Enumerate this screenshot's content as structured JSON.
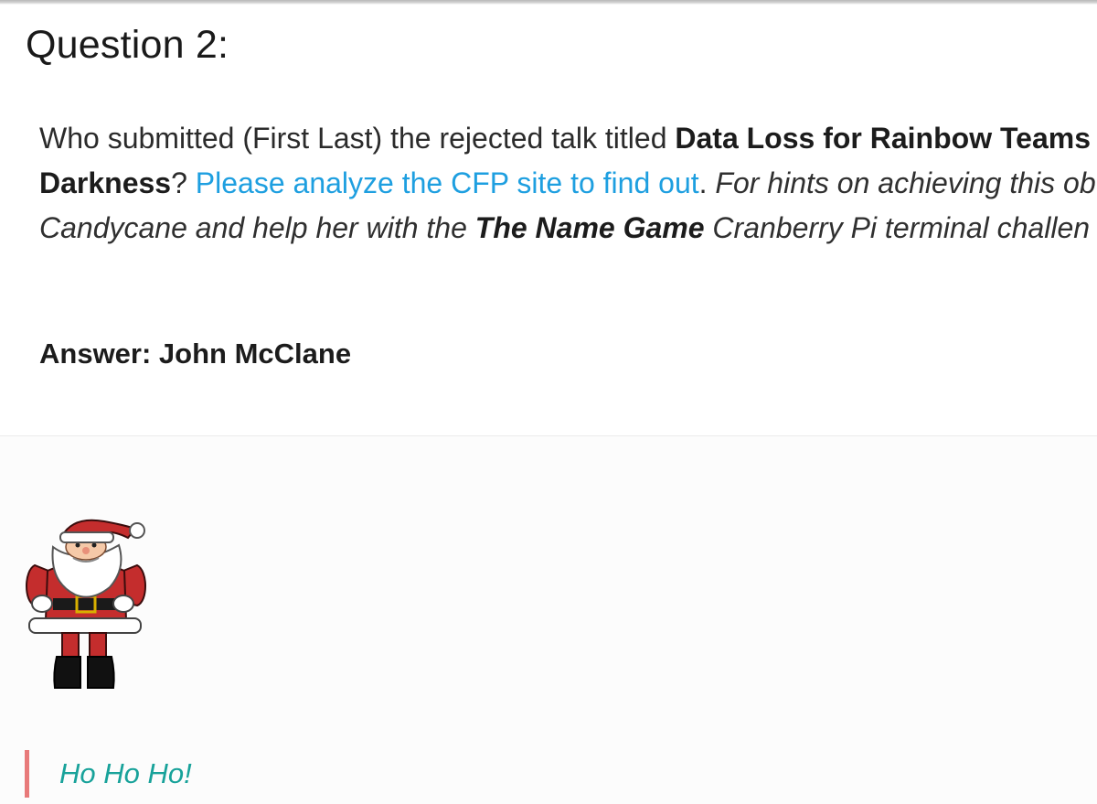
{
  "question": {
    "title": "Question 2:",
    "intro": "Who submitted (First Last) the rejected talk titled ",
    "talk_title_part1": "Data Loss for Rainbow Teams",
    "talk_title_part2": "Darkness",
    "after_title": "? ",
    "link_text": "Please analyze the CFP site to find out",
    "after_link": ". ",
    "hint_part1": "For hints on achieving this ob",
    "hint_part2": "Candycane and help her with the ",
    "hint_challenge": "The Name Game",
    "hint_part3": " Cranberry Pi terminal challen"
  },
  "answer": {
    "text": "Answer: John McClane"
  },
  "quote": {
    "text": "Ho Ho Ho!"
  },
  "colors": {
    "link": "#1e9fe0",
    "quote_text": "#18a29a",
    "quote_border": "#e87a7a"
  },
  "icons": {
    "santa": "santa-claus-image"
  }
}
